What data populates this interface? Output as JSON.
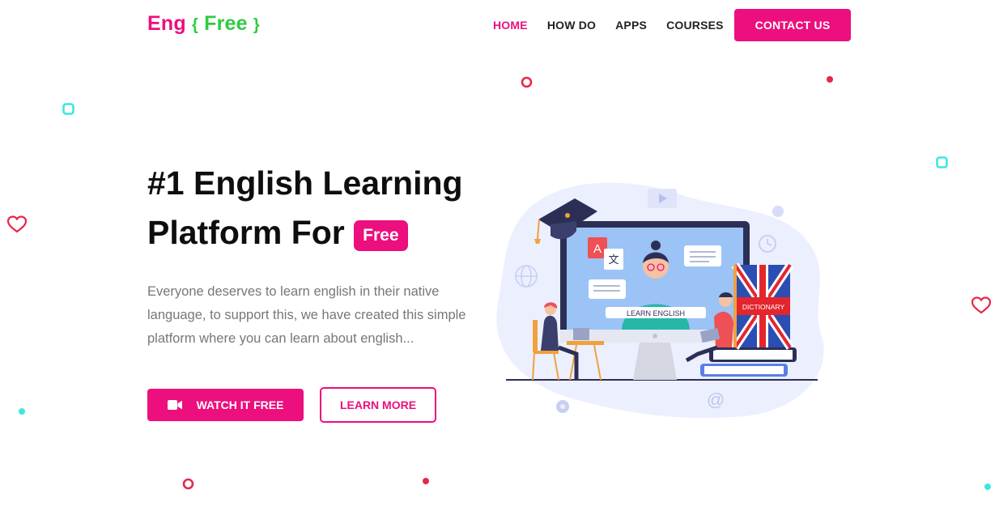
{
  "logo": {
    "eng": "Eng",
    "open": "{",
    "free": "Free",
    "close": "}"
  },
  "nav": {
    "items": [
      "HOME",
      "HOW DO",
      "APPS",
      "COURSES"
    ],
    "contact": "CONTACT US"
  },
  "hero": {
    "title_line1": "#1 English Learning",
    "title_line2": "Platform For",
    "badge": "Free",
    "description": "Everyone deserves to learn english in their native language, to support this, we have created this simple platform where you can learn about english...",
    "watch_label": "WATCH IT FREE",
    "learn_label": "LEARN MORE"
  },
  "illustration": {
    "screen_caption": "LEARN ENGLISH",
    "book_label": "DICTIONARY",
    "letter_a": "A",
    "letter_x": "文",
    "at_sign": "@"
  },
  "colors": {
    "accent": "#ec0f7d",
    "green": "#2ecc40",
    "cyan": "#3ee6e0",
    "red": "#e8264a"
  },
  "icons": [
    "video-camera-icon",
    "heart-icon",
    "ring-icon",
    "dot-icon",
    "square-outline-icon"
  ]
}
